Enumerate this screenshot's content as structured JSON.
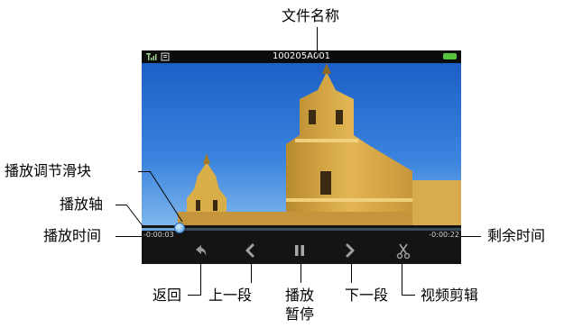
{
  "callouts": {
    "file_name": "文件名称",
    "seek_slider": "播放调节滑块",
    "seek_bar": "播放轴",
    "elapsed_time": "播放时间",
    "remaining_time": "剩余时间",
    "back": "返回",
    "previous": "上一段",
    "play_pause_line1": "播放",
    "play_pause_line2": "暂停",
    "next": "下一段",
    "video_edit": "视频剪辑"
  },
  "player": {
    "file_name": "100205A001",
    "elapsed": "-0:00:03",
    "remaining": "-0:00:22",
    "progress_fraction": 0.12,
    "state": "paused"
  },
  "status_bar": {
    "icons": [
      "signal-icon",
      "sd-card-icon",
      "battery-icon"
    ]
  },
  "controls": {
    "icons": [
      "back-arrow-icon",
      "previous-segment-icon",
      "pause-icon",
      "next-segment-icon",
      "scissors-icon"
    ]
  },
  "colors": {
    "control_bar": "#141414",
    "seek_played": "#6ea6e0",
    "battery": "#56c43c"
  }
}
